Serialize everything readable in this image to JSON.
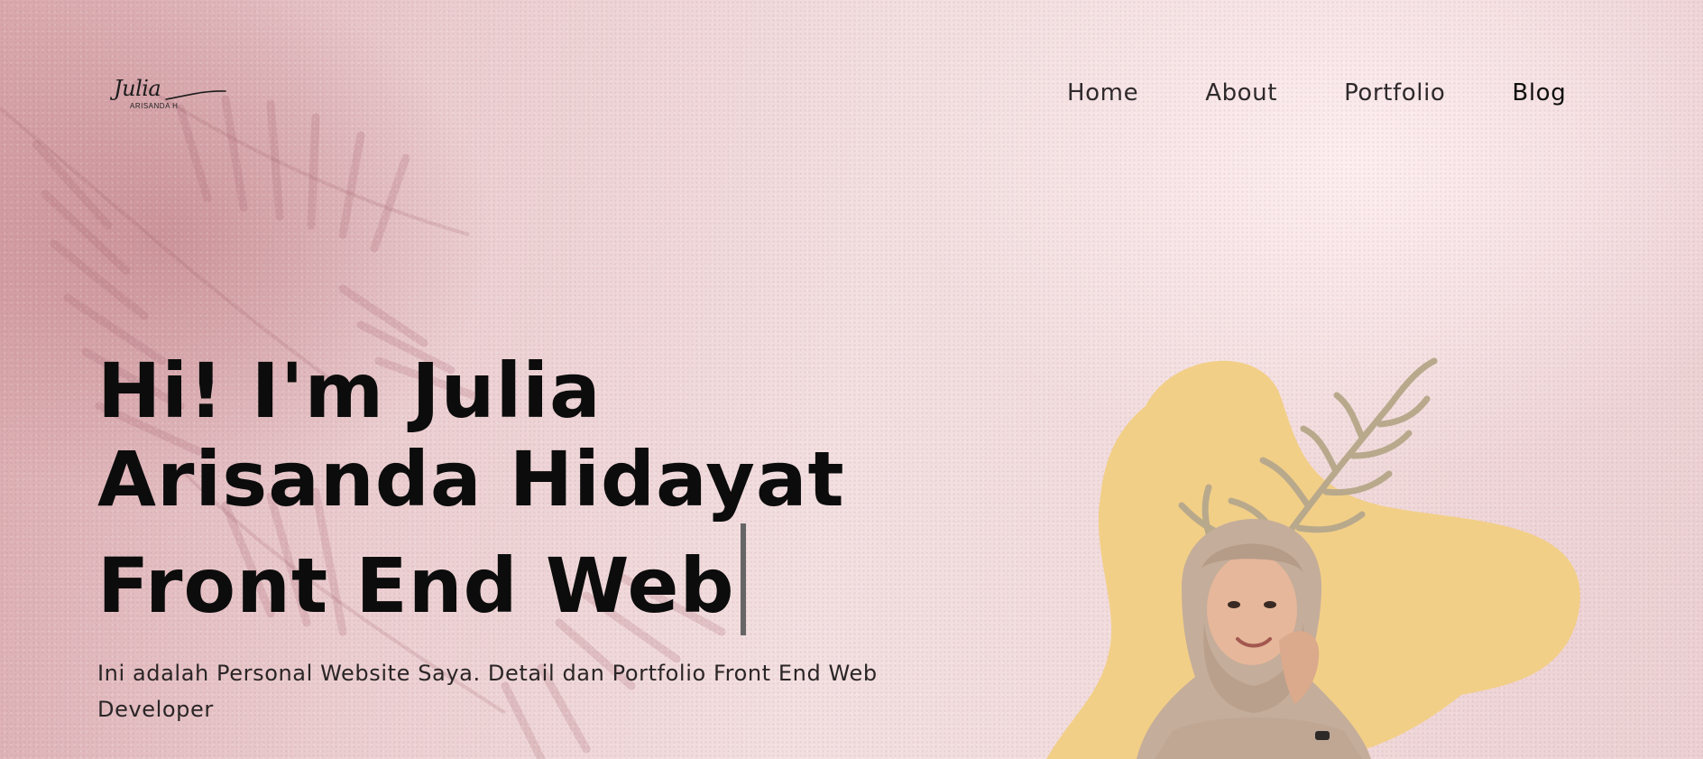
{
  "header": {
    "logo": {
      "script": "Julia",
      "sub": "ARISANDA H"
    },
    "nav": [
      {
        "label": "Home"
      },
      {
        "label": "About"
      },
      {
        "label": "Portfolio"
      },
      {
        "label": "Blog"
      }
    ]
  },
  "hero": {
    "title_line_1": "Hi! I'm Julia",
    "title_line_2": "Arisanda Hidayat",
    "title_line_3": "Front End Web",
    "description": "Ini adalah Personal Website Saya. Detail dan Portfolio Front End Web Developer"
  },
  "colors": {
    "background": "#f1dadb",
    "leaf_shadow": "#b87a82",
    "blob": "#f2cf87",
    "sprig": "#b8a98c",
    "text": "#0c0c0c"
  }
}
